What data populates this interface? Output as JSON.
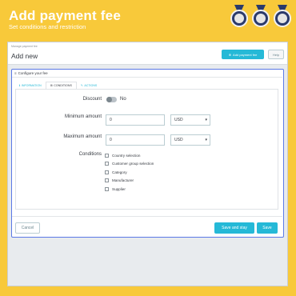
{
  "hero": {
    "title": "Add payment fee",
    "subtitle": "Set conditions and restriction"
  },
  "badges": [
    "medal-icon",
    "medal-icon",
    "medal-icon"
  ],
  "frame": {
    "breadcrumb": "Manage payment fee",
    "title": "Add new",
    "add_button": "Add payment fee",
    "add_icon": "plus-circle-icon",
    "help_button": "Help"
  },
  "card": {
    "title": "Configure your fee",
    "title_icon": "list-icon",
    "tabs": [
      {
        "label": "INFORMATION",
        "icon": "info-icon",
        "active": false
      },
      {
        "label": "CONDITIONS",
        "icon": "filter-icon",
        "active": true
      },
      {
        "label": "ACTIONS",
        "icon": "wrench-icon",
        "active": false
      }
    ]
  },
  "form": {
    "discount_label": "Discount",
    "discount_toggle_text": "No",
    "discount_enabled": false,
    "min_label": "Minimum amount",
    "min_value": "0",
    "min_currency": "USD",
    "max_label": "Maximum amount",
    "max_value": "0",
    "max_currency": "USD",
    "conditions_label": "Conditions",
    "conditions": [
      "Country selection",
      "Customer group selection",
      "Category",
      "Manufacturer",
      "Supplier"
    ]
  },
  "footer": {
    "cancel": "Cancel",
    "save_and_stay": "Save and stay",
    "save": "Save"
  },
  "colors": {
    "background": "#f8c93a",
    "accent": "#25b9d7",
    "card_border": "#5b79e6"
  }
}
